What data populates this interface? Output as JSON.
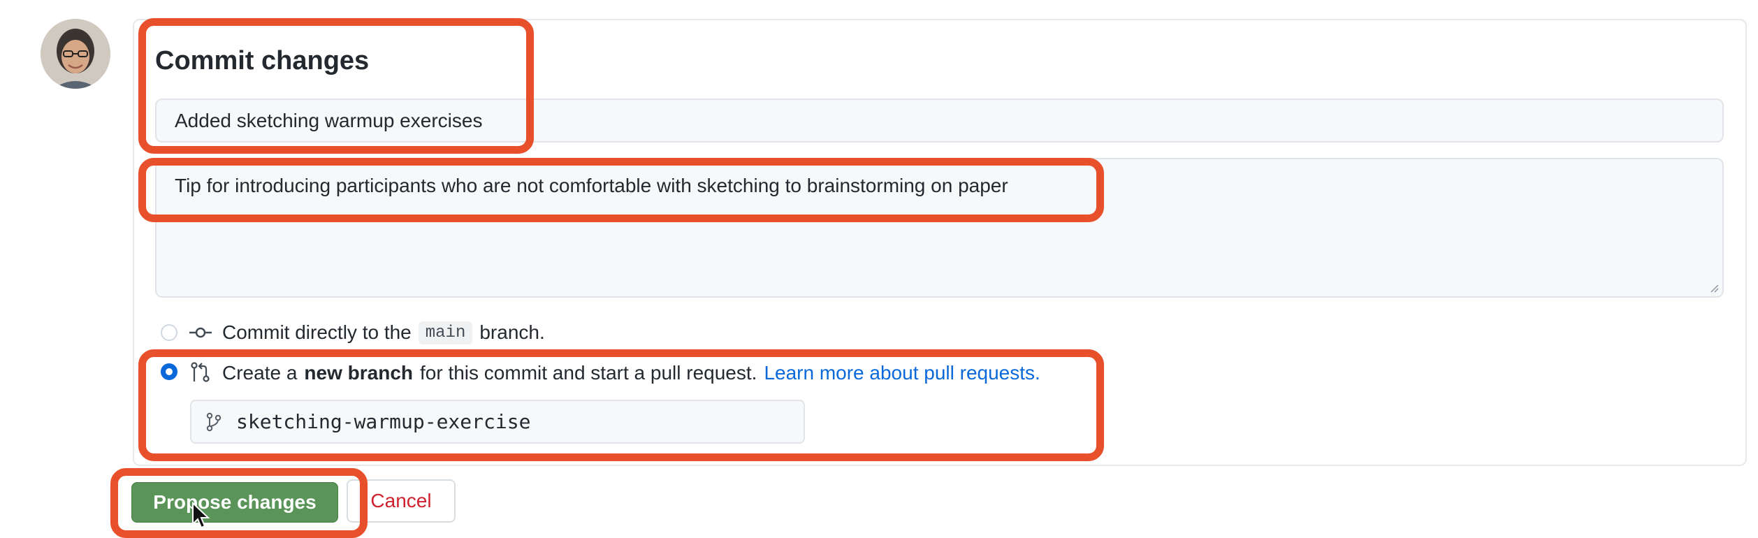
{
  "commit": {
    "title": "Commit changes",
    "summary_value": "Added sketching warmup exercises",
    "description_value": "Tip for introducing participants who are not comfortable with sketching to brainstorming on paper"
  },
  "options": {
    "direct": {
      "prefix": "Commit directly to the",
      "branch_code": "main",
      "suffix": "branch."
    },
    "new_branch": {
      "prefix": "Create a",
      "bold": "new branch",
      "suffix": "for this commit and start a pull request.",
      "link": "Learn more about pull requests.",
      "selected": true
    },
    "branch_name": "sketching-warmup-exercise"
  },
  "buttons": {
    "propose": "Propose changes",
    "cancel": "Cancel"
  },
  "icons": {
    "avatar": "user-avatar",
    "direct": "git-commit-icon",
    "pr": "git-pull-request-icon",
    "branch": "git-branch-icon"
  },
  "colors": {
    "highlight": "#e8502c",
    "primary_button": "#5a9458",
    "link": "#0969da",
    "cancel_text": "#cf222e"
  }
}
